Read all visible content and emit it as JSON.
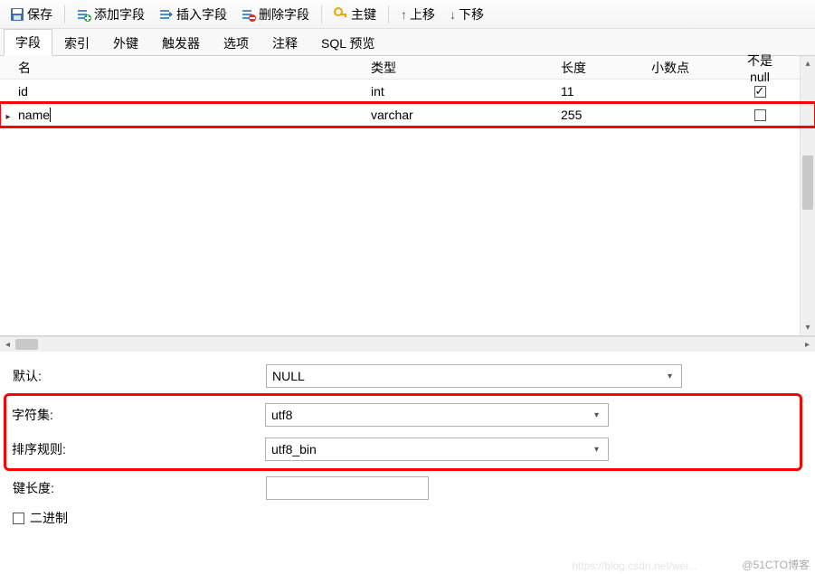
{
  "toolbar": {
    "save": "保存",
    "add_field": "添加字段",
    "insert_field": "插入字段",
    "delete_field": "删除字段",
    "primary_key": "主键",
    "move_up": "上移",
    "move_down": "下移"
  },
  "tabs": {
    "fields": "字段",
    "indexes": "索引",
    "foreign_keys": "外键",
    "triggers": "触发器",
    "options": "选项",
    "comment": "注释",
    "sql_preview": "SQL 预览"
  },
  "grid": {
    "headers": {
      "name": "名",
      "type": "类型",
      "length": "长度",
      "decimals": "小数点",
      "not_null": "不是 null"
    },
    "rows": [
      {
        "name": "id",
        "type": "int",
        "length": "11",
        "decimals": "",
        "not_null": true,
        "editing": false
      },
      {
        "name": "name",
        "type": "varchar",
        "length": "255",
        "decimals": "",
        "not_null": false,
        "editing": true
      }
    ]
  },
  "props": {
    "default_label": "默认:",
    "default_value": "NULL",
    "charset_label": "字符集:",
    "charset_value": "utf8",
    "collation_label": "排序规则:",
    "collation_value": "utf8_bin",
    "key_length_label": "键长度:",
    "key_length_value": "",
    "binary_label": "二进制",
    "binary_checked": false
  },
  "watermark1": "@51CTO博客",
  "watermark2": "https://blog.csdn.net/wei..."
}
